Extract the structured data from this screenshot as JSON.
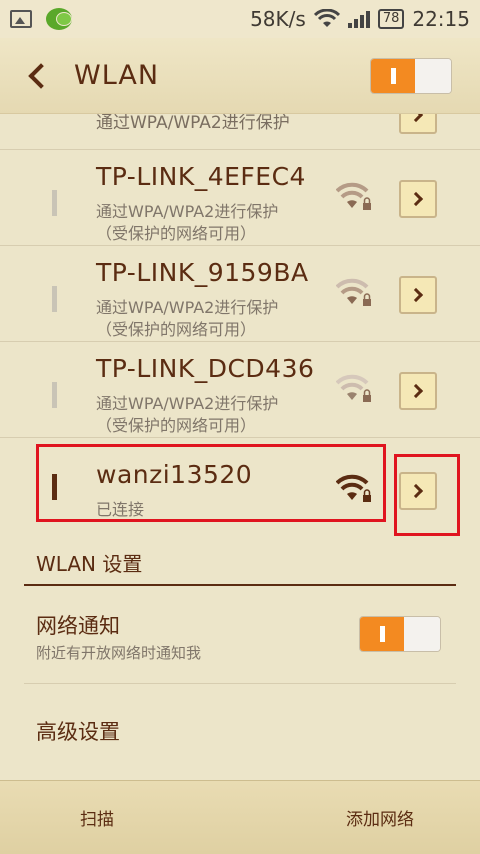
{
  "status_bar": {
    "speed": "58K/s",
    "battery": "78",
    "time": "22:15"
  },
  "header": {
    "title": "WLAN",
    "wlan_enabled": true
  },
  "networks_peek": {
    "subtitle": "通过WPA/WPA2进行保护"
  },
  "networks": [
    {
      "ssid": "TP-LINK_4EFEC4",
      "line1": "通过WPA/WPA2进行保护",
      "line2": "（受保护的网络可用）",
      "connected": false
    },
    {
      "ssid": "TP-LINK_9159BA",
      "line1": "通过WPA/WPA2进行保护",
      "line2": "（受保护的网络可用）",
      "connected": false
    },
    {
      "ssid": "TP-LINK_DCD436",
      "line1": "通过WPA/WPA2进行保护",
      "line2": "（受保护的网络可用）",
      "connected": false
    },
    {
      "ssid": "wanzi13520",
      "line1": "已连接",
      "line2": "",
      "connected": true
    }
  ],
  "settings": {
    "section_title": "WLAN 设置",
    "notify_title": "网络通知",
    "notify_sub": "附近有开放网络时通知我",
    "notify_enabled": true,
    "advanced_title": "高级设置"
  },
  "bottom_bar": {
    "scan_label": "扫描",
    "add_label": "添加网络"
  },
  "colors": {
    "accent": "#f38a21",
    "highlight": "#e0141f",
    "brown": "#5b2c12",
    "background": "#ece5c9"
  }
}
